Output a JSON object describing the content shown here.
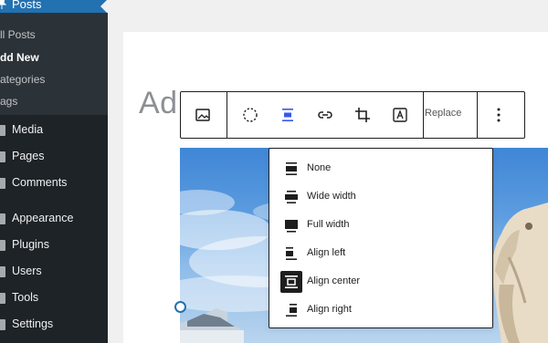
{
  "sidebar": {
    "posts_label": "Posts",
    "submenu": [
      {
        "label": "ll Posts",
        "current": false
      },
      {
        "label": "dd New",
        "current": true
      },
      {
        "label": "ategories",
        "current": false
      },
      {
        "label": "ags",
        "current": false
      }
    ],
    "menu": [
      {
        "label": "Media",
        "icon": "media-icon"
      },
      {
        "label": "Pages",
        "icon": "pages-icon"
      },
      {
        "label": "Comments",
        "icon": "comments-icon"
      },
      {
        "label": "Appearance",
        "icon": "appearance-icon"
      },
      {
        "label": "Plugins",
        "icon": "plugins-icon"
      },
      {
        "label": "Users",
        "icon": "users-icon"
      },
      {
        "label": "Tools",
        "icon": "tools-icon"
      },
      {
        "label": "Settings",
        "icon": "settings-icon"
      }
    ]
  },
  "editor": {
    "title_text": "Ad"
  },
  "toolbar": {
    "replace_label": "Replace",
    "buttons": [
      "image-icon",
      "circle-dashed-icon",
      "align-center-icon",
      "link-icon",
      "crop-icon",
      "text-overlay-icon"
    ]
  },
  "align_menu": {
    "options": [
      {
        "label": "None",
        "icon": "align-none-icon",
        "active": false
      },
      {
        "label": "Wide width",
        "icon": "align-wide-icon",
        "active": false
      },
      {
        "label": "Full width",
        "icon": "align-full-icon",
        "active": false
      },
      {
        "label": "Align left",
        "icon": "align-left-icon",
        "active": false
      },
      {
        "label": "Align center",
        "icon": "align-center-icon",
        "active": true
      },
      {
        "label": "Align right",
        "icon": "align-right-icon",
        "active": false
      }
    ]
  },
  "colors": {
    "sidebar_bg": "#1d2327",
    "sidebar_active": "#2271b1",
    "submenu_bg": "#2c3338",
    "accent": "#3858e9"
  }
}
